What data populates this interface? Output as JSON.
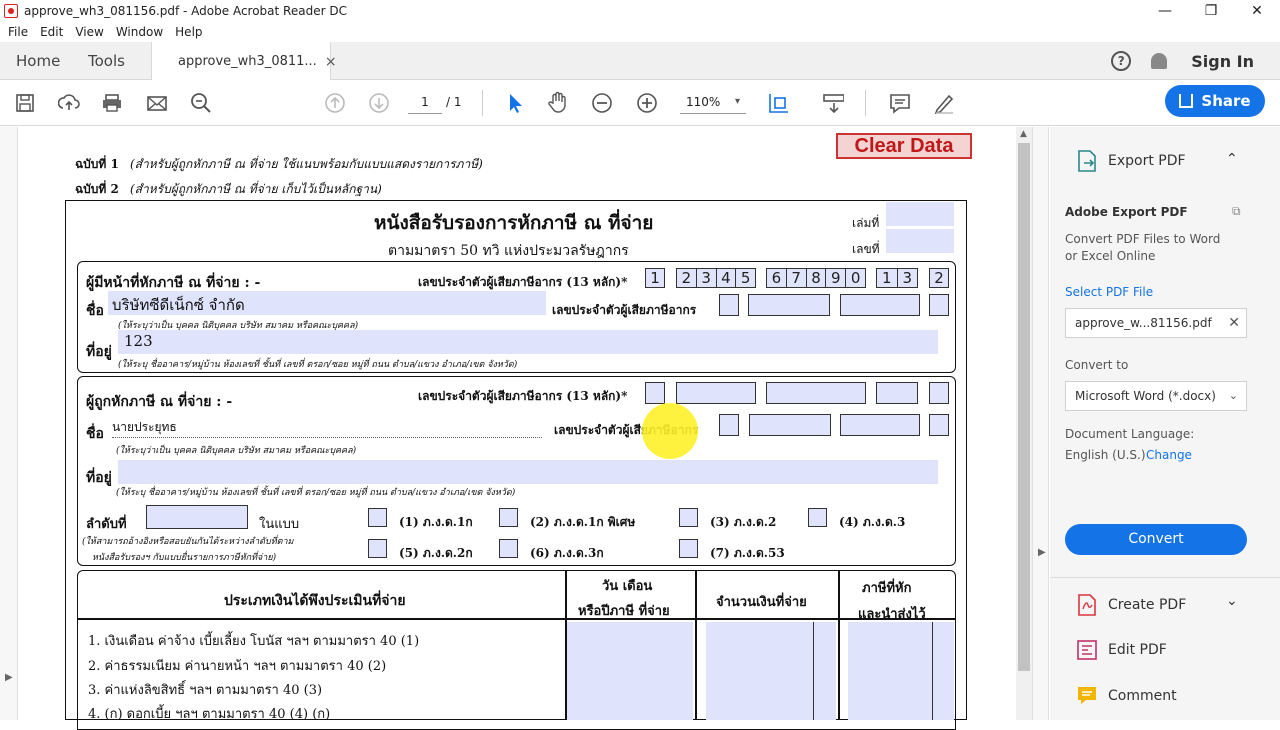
{
  "window": {
    "title": "approve_wh3_081156.pdf - Adobe Acrobat Reader DC",
    "minimize": "—",
    "restore": "❐",
    "close": "✕"
  },
  "menu": [
    "File",
    "Edit",
    "View",
    "Window",
    "Help"
  ],
  "tabs": {
    "home": "Home",
    "tools": "Tools",
    "doc": "approve_wh3_0811...",
    "doc_close": "×"
  },
  "header_right": {
    "help": "?",
    "signin": "Sign In"
  },
  "toolbar": {
    "page_current": "1",
    "page_total": "/ 1",
    "zoom": "110%",
    "share": "Share"
  },
  "doc": {
    "clear_button": "Clear Data",
    "copy1": "ฉบับที่ 1",
    "copy1_desc": "(สำหรับผู้ถูกหักภาษี ณ ที่จ่าย ใช้แนบพร้อมกับแบบแสดงรายการภาษี)",
    "copy2": "ฉบับที่ 2",
    "copy2_desc": "(สำหรับผู้ถูกหักภาษี ณ ที่จ่าย เก็บไว้เป็นหลักฐาน)",
    "title": "หนังสือรับรองการหักภาษี ณ ที่จ่าย",
    "subtitle": "ตามมาตรา 50 ทวิ แห่งประมวลรัษฎากร",
    "book_no": "เล่มที่",
    "doc_no": "เลขที่",
    "payer_label": "ผู้มีหน้าที่หักภาษี ณ ที่จ่าย : -",
    "taxid13": "เลขประจำตัวผู้เสียภาษีอากร (13 หลัก)*",
    "payer_taxid_digits": [
      "1",
      "2",
      "3",
      "4",
      "5",
      "6",
      "7",
      "8",
      "9",
      "0",
      "1",
      "3",
      "2"
    ],
    "name_label": "ชื่อ",
    "payer_name": "บริษัทซีดีเน็กซ์ จำกัด",
    "taxid_label": "เลขประจำตัวผู้เสียภาษีอากร",
    "name_hint": "(ให้ระบุว่าเป็น บุคคล นิติบุคคล บริษัท สมาคม หรือคณะบุคคล)",
    "addr_label": "ที่อยู่",
    "payer_addr": "123",
    "addr_hint": "(ให้ระบุ ชื่ออาคาร/หมู่บ้าน ห้องเลขที่ ชั้นที่ เลขที่ ตรอก/ซอย หมู่ที่ ถนน ตำบล/แขวง อำเภอ/เขต จังหวัด)",
    "payee_label": "ผู้ถูกหักภาษี ณ ที่จ่าย : -",
    "payee_name": "นายประยุทธ",
    "seq_label": "ลำดับที่",
    "in_form": "ในแบบ",
    "seq_hint1": "(ให้สามารถอ้างอิงหรือสอบยันกันได้ระหว่างลำดับที่ตาม",
    "seq_hint2": "หนังสือรับรองฯ กับแบบยื่นรายการภาษีหักที่จ่าย)",
    "forms": [
      "(1) ภ.ง.ด.1ก",
      "(2) ภ.ง.ด.1ก พิเศษ",
      "(3) ภ.ง.ด.2",
      "(4) ภ.ง.ด.3",
      "(5) ภ.ง.ด.2ก",
      "(6) ภ.ง.ด.3ก",
      "(7) ภ.ง.ด.53"
    ],
    "col_type": "ประเภทเงินได้พึงประเมินที่จ่าย",
    "col_date1": "วัน เดือน",
    "col_date2": "หรือปีภาษี ที่จ่าย",
    "col_amount": "จำนวนเงินที่จ่าย",
    "col_tax1": "ภาษีที่หัก",
    "col_tax2": "และนำส่งไว้",
    "rows": [
      "1. เงินเดือน ค่าจ้าง เบี้ยเลี้ยง โบนัส ฯลฯ ตามมาตรา 40 (1)",
      "2. ค่าธรรมเนียม ค่านายหน้า ฯลฯ ตามมาตรา 40 (2)",
      "3. ค่าแห่งลิขสิทธิ์ ฯลฯ ตามมาตรา 40 (3)",
      "4. (ก) ดอกเบี้ย ฯลฯ ตามมาตรา 40 (4) (ก)"
    ]
  },
  "panel": {
    "export_title": "Export PDF",
    "adobe_export": "Adobe Export PDF",
    "desc": "Convert PDF Files to Word or Excel Online",
    "select_file": "Select PDF File",
    "file_name": "approve_w...81156.pdf",
    "convert_to": "Convert to",
    "format": "Microsoft Word (*.docx)",
    "doc_lang": "Document Language:",
    "lang": "English (U.S.)",
    "change": "Change",
    "convert_btn": "Convert",
    "create_pdf": "Create PDF",
    "edit_pdf": "Edit PDF",
    "comment": "Comment"
  },
  "colors": {
    "accent": "#1473e6",
    "field": "#dfe3fb",
    "clear_red": "#c01818"
  }
}
